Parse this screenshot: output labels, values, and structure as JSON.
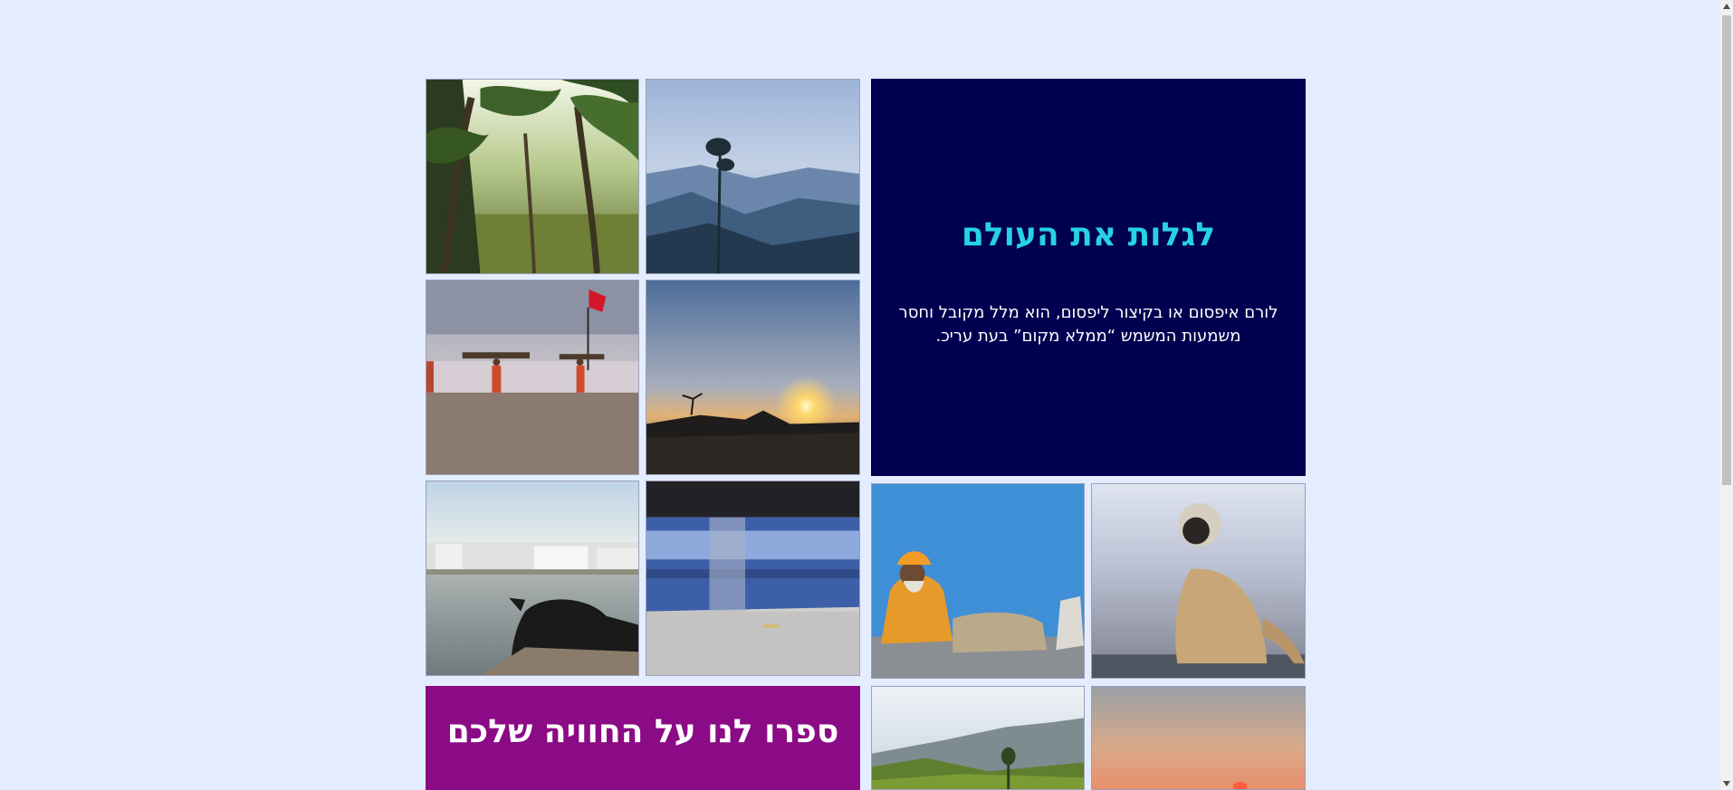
{
  "hero": {
    "title": "לגלות את העולם",
    "text": "לורם איפסום או בקיצור ליפסום, הוא מלל מקובל וחסר משמעות המשמש “ממלא מקום” בעת עריכ."
  },
  "cta": {
    "title": "ספרו לנו על החוויה שלכם"
  },
  "gallery": {
    "photos": [
      "palm-forest",
      "misty-mountains",
      "beach-carriers",
      "sunset-tidal-flat",
      "lake-town-cow",
      "blue-train",
      "sadhu-blue-wall",
      "langur-monkey",
      "tea-hills",
      "hazy-sunset"
    ]
  },
  "colors": {
    "page_background": "#e4edff",
    "hero_background": "#000050",
    "hero_title": "#27d3e2",
    "cta_background": "#8b0a85"
  }
}
